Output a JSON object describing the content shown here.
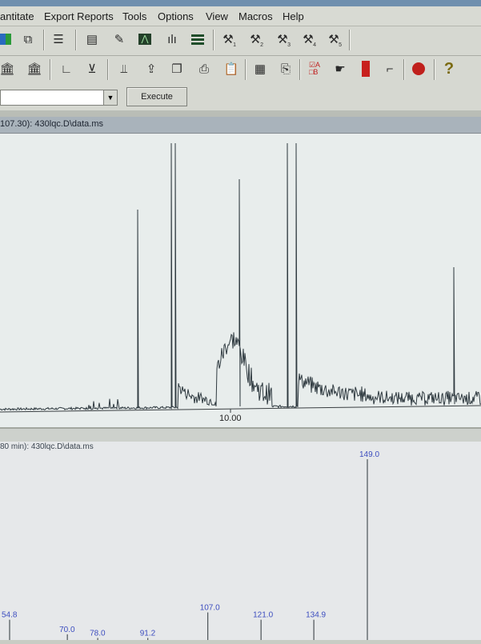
{
  "menu": {
    "items": [
      "antitate",
      "Export Reports",
      "Tools",
      "Options",
      "View",
      "Macros",
      "Help"
    ]
  },
  "toolbar1": {
    "icons": [
      "grid-icon",
      "layout-icon",
      "list-icon",
      "report-icon",
      "edit-icon",
      "chart-icon",
      "bar-chart-icon",
      "spectrum-icon",
      "macro-1-icon",
      "macro-2-icon",
      "macro-3-icon",
      "macro-4-icon",
      "macro-5-icon"
    ],
    "macro_numbers": [
      "1",
      "2",
      "3",
      "4",
      "5"
    ]
  },
  "toolbar2": {
    "icons": [
      "library-icon",
      "library-search-icon",
      "baseline-icon",
      "integrate-icon",
      "calibrate-icon",
      "upload-icon",
      "copy-icon",
      "print-icon",
      "clipboard-icon",
      "report-doc-icon",
      "export-icon",
      "compare-ab-icon",
      "hand-icon",
      "tower-icon",
      "tool-icon",
      "stop-icon",
      "help-icon"
    ]
  },
  "controls": {
    "combo_value": "",
    "execute_label": "Execute"
  },
  "chromatogram": {
    "title": "107.30): 430lqc.D\\data.ms",
    "x_tick": "10.00"
  },
  "spectrum": {
    "title": "80 min): 430lqc.D\\data.ms",
    "peaks": [
      {
        "mz": "54.8",
        "rel": 0.12
      },
      {
        "mz": "70.0",
        "rel": 0.04
      },
      {
        "mz": "78.0",
        "rel": 0.02
      },
      {
        "mz": "91.2",
        "rel": 0.02
      },
      {
        "mz": "107.0",
        "rel": 0.16
      },
      {
        "mz": "121.0",
        "rel": 0.12
      },
      {
        "mz": "134.9",
        "rel": 0.12
      },
      {
        "mz": "149.0",
        "rel": 1.0
      }
    ]
  },
  "colors": {
    "trace": "#2f3a40",
    "spectrum_label": "#3c4dbf"
  }
}
